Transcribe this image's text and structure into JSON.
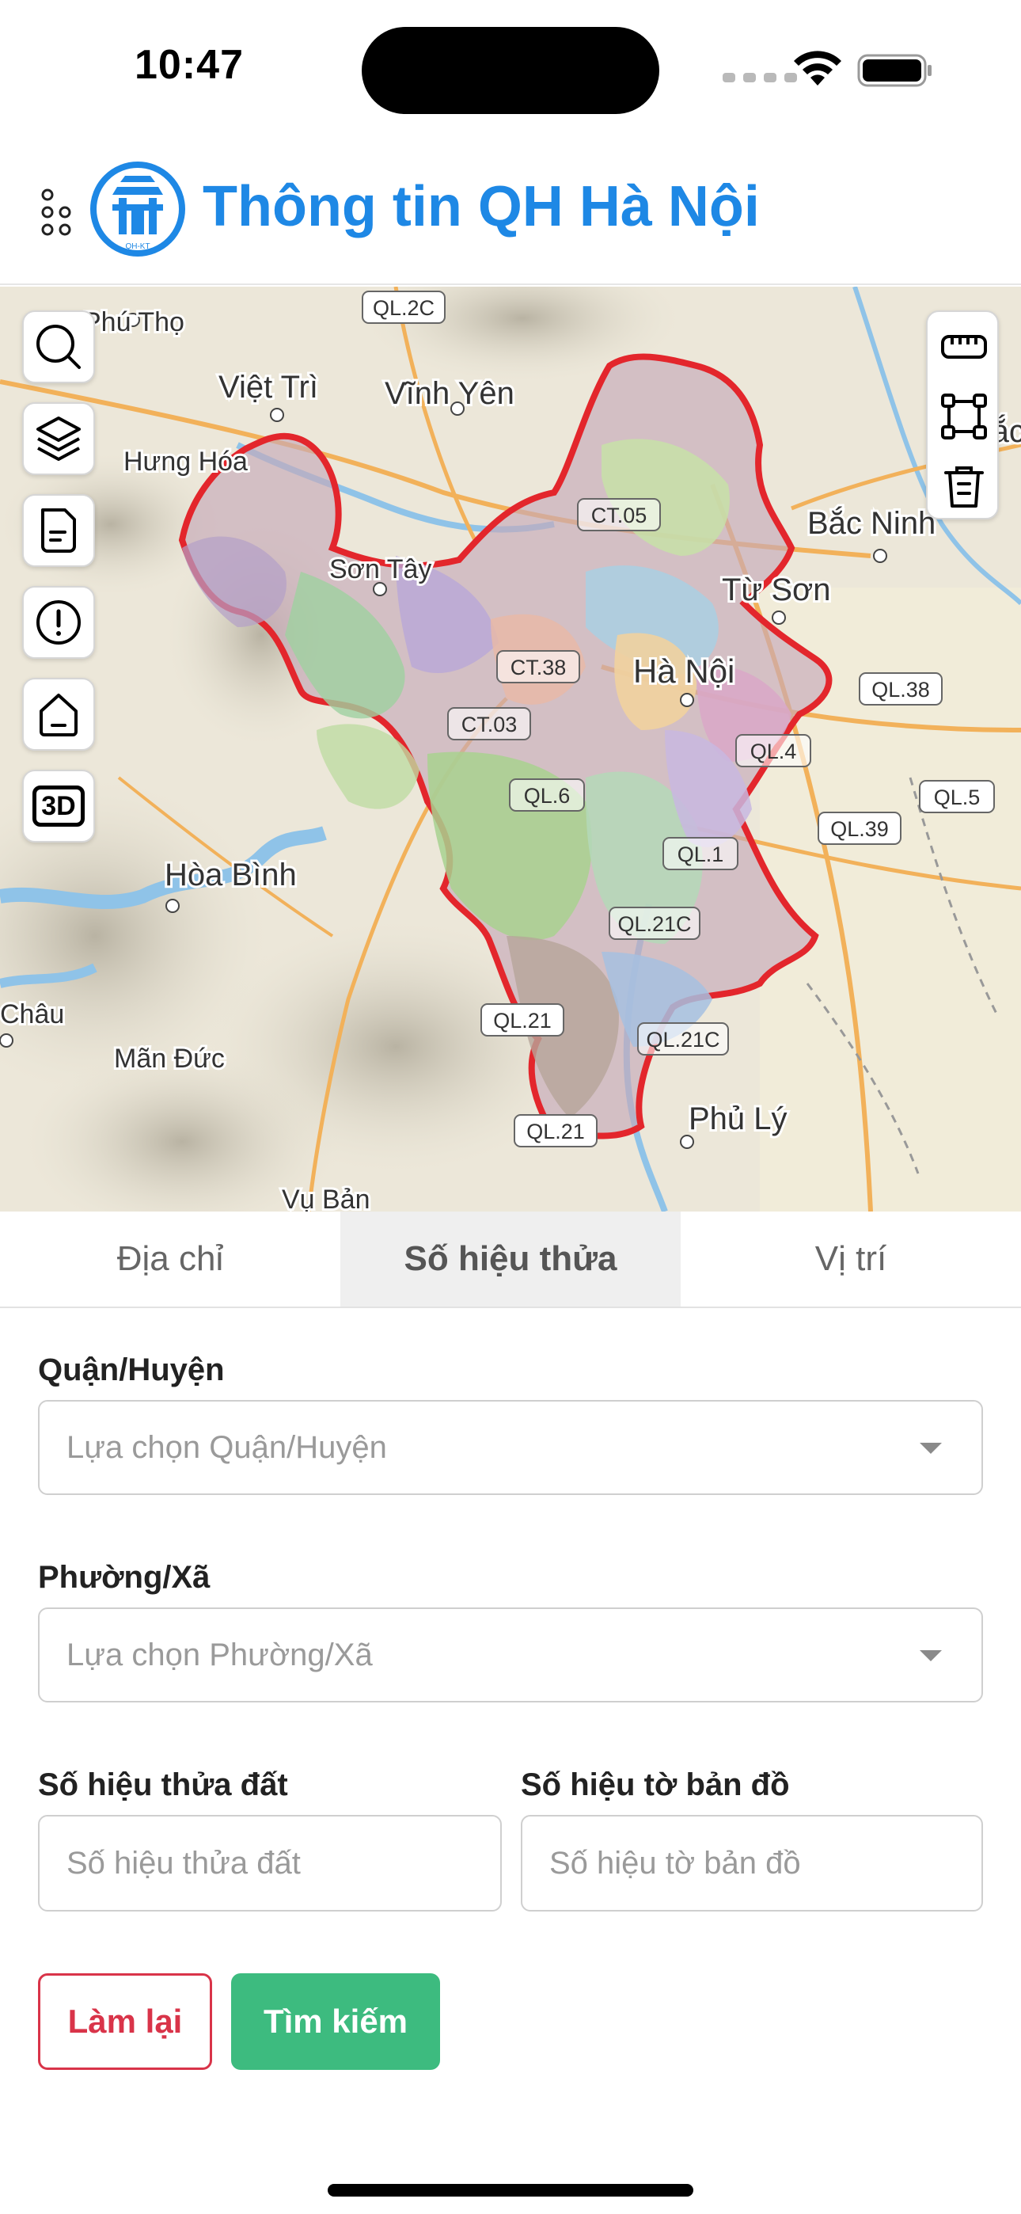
{
  "status_bar": {
    "time": "10:47"
  },
  "header": {
    "title": "Thông tin QH Hà Nội",
    "logo_text": "QH-KT"
  },
  "map": {
    "places": [
      {
        "id": "phu-tho",
        "name": "Phú Thọ"
      },
      {
        "id": "viet-tri",
        "name": "Việt Trì"
      },
      {
        "id": "vinh-yen",
        "name": "Vĩnh Yên"
      },
      {
        "id": "hung-hoa",
        "name": "Hưng Hóa"
      },
      {
        "id": "son-tay",
        "name": "Sơn Tây"
      },
      {
        "id": "bac-ninh",
        "name": "Bắc Ninh"
      },
      {
        "id": "bac-giang",
        "name": "Bắc Gi"
      },
      {
        "id": "tu-son",
        "name": "Từ Sơn"
      },
      {
        "id": "ha-noi",
        "name": "Hà Nội"
      },
      {
        "id": "hoa-binh",
        "name": "Hòa Bình"
      },
      {
        "id": "chau",
        "name": "Châu"
      },
      {
        "id": "man-duc",
        "name": "Mãn Đức"
      },
      {
        "id": "phu-ly",
        "name": "Phủ Lý"
      },
      {
        "id": "vu-ban",
        "name": "Vụ Bản"
      }
    ],
    "road_labels": [
      "QL.2C",
      "CT.05",
      "CT.38",
      "CT.03",
      "QL.38",
      "QL.4",
      "QL.6",
      "QL.39",
      "QL.5",
      "QL.1",
      "QL.21C",
      "QL.21",
      "QL.21C",
      "QL.21"
    ],
    "left_controls": [
      {
        "id": "search",
        "icon": "search-icon"
      },
      {
        "id": "layers",
        "icon": "layers-icon"
      },
      {
        "id": "document",
        "icon": "document-icon"
      },
      {
        "id": "info",
        "icon": "alert-circle-icon"
      },
      {
        "id": "home",
        "icon": "home-icon"
      },
      {
        "id": "3d",
        "label": "3D"
      }
    ],
    "right_tools": [
      {
        "id": "measure",
        "icon": "ruler-icon"
      },
      {
        "id": "area",
        "icon": "polygon-icon"
      },
      {
        "id": "delete",
        "icon": "trash-icon"
      }
    ]
  },
  "tabs": [
    {
      "label": "Địa chỉ",
      "active": false
    },
    {
      "label": "Số hiệu thửa",
      "active": true
    },
    {
      "label": "Vị trí",
      "active": false
    }
  ],
  "form": {
    "district": {
      "label": "Quận/Huyện",
      "placeholder": "Lựa chọn Quận/Huyện"
    },
    "ward": {
      "label": "Phường/Xã",
      "placeholder": "Lựa chọn Phường/Xã"
    },
    "parcel": {
      "label": "Số hiệu thửa đất",
      "placeholder": "Số hiệu thửa đất"
    },
    "sheet": {
      "label": "Số hiệu tờ bản đồ",
      "placeholder": "Số hiệu tờ bản đồ"
    },
    "reset_label": "Làm lại",
    "search_label": "Tìm kiếm"
  },
  "colors": {
    "accent": "#1e88e5",
    "danger": "#d93449",
    "success": "#3dbb7f",
    "boundary": "#e3262c"
  }
}
